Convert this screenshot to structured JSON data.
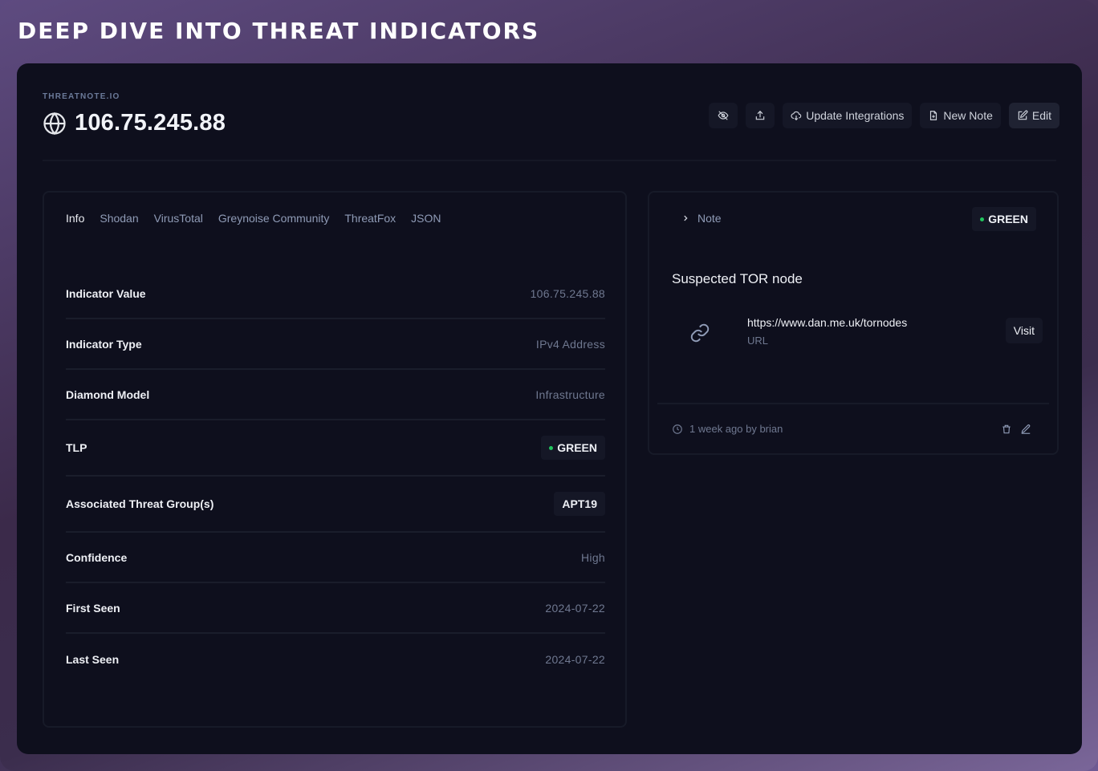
{
  "banner": {
    "title": "DEEP DIVE INTO THREAT INDICATORS"
  },
  "header": {
    "brand": "THREATNOTE.IO",
    "indicator": "106.75.245.88",
    "buttons": {
      "update_integrations": "Update Integrations",
      "new_note": "New Note",
      "edit": "Edit"
    }
  },
  "tabs": [
    "Info",
    "Shodan",
    "VirusTotal",
    "Greynoise Community",
    "ThreatFox",
    "JSON"
  ],
  "active_tab": "Info",
  "info_rows": [
    {
      "label": "Indicator Value",
      "value": "106.75.245.88"
    },
    {
      "label": "Indicator Type",
      "value": "IPv4 Address"
    },
    {
      "label": "Diamond Model",
      "value": "Infrastructure"
    },
    {
      "label": "TLP",
      "value": "GREEN"
    },
    {
      "label": "Associated Threat Group(s)",
      "value": "APT19"
    },
    {
      "label": "Confidence",
      "value": "High"
    },
    {
      "label": "First Seen",
      "value": "2024-07-22"
    },
    {
      "label": "Last Seen",
      "value": "2024-07-22"
    }
  ],
  "note": {
    "toggle_label": "Note",
    "tlp": "GREEN",
    "title": "Suspected TOR node",
    "link": {
      "url": "https://www.dan.me.uk/tornodes",
      "type": "URL",
      "visit_label": "Visit"
    },
    "footer": "1 week ago by brian"
  },
  "colors": {
    "tlp_green": "#22c55e",
    "panel_bg": "#0e0f1d",
    "tab_link": "#8f9bb6"
  }
}
